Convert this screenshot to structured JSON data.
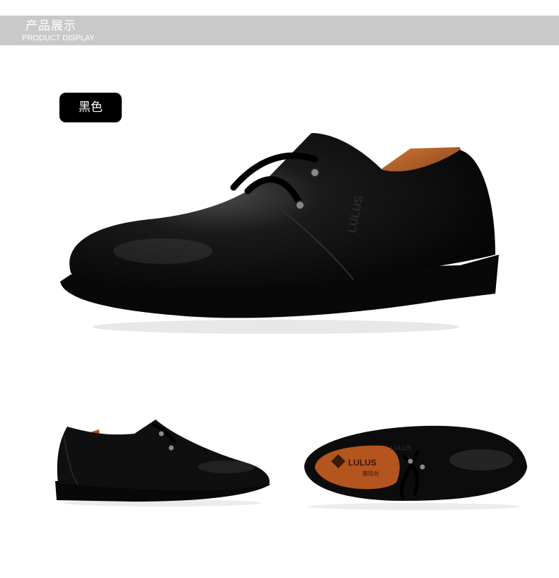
{
  "header": {
    "title_cn": "产品展示",
    "title_en": "PRODUCT DISPLAY"
  },
  "color_tag": "黑色",
  "insole_brand": {
    "logo_text": "LULUS",
    "sub_text": "鹿陆丝"
  },
  "emboss_text": "LULUS",
  "colors": {
    "header_bg": "#c9c9c9",
    "tag_bg": "#000000",
    "leather": "#0c0c0c",
    "lining": "#b4541e"
  },
  "icons": [
    "shoe-main-image",
    "shoe-side-image",
    "shoe-top-image"
  ]
}
